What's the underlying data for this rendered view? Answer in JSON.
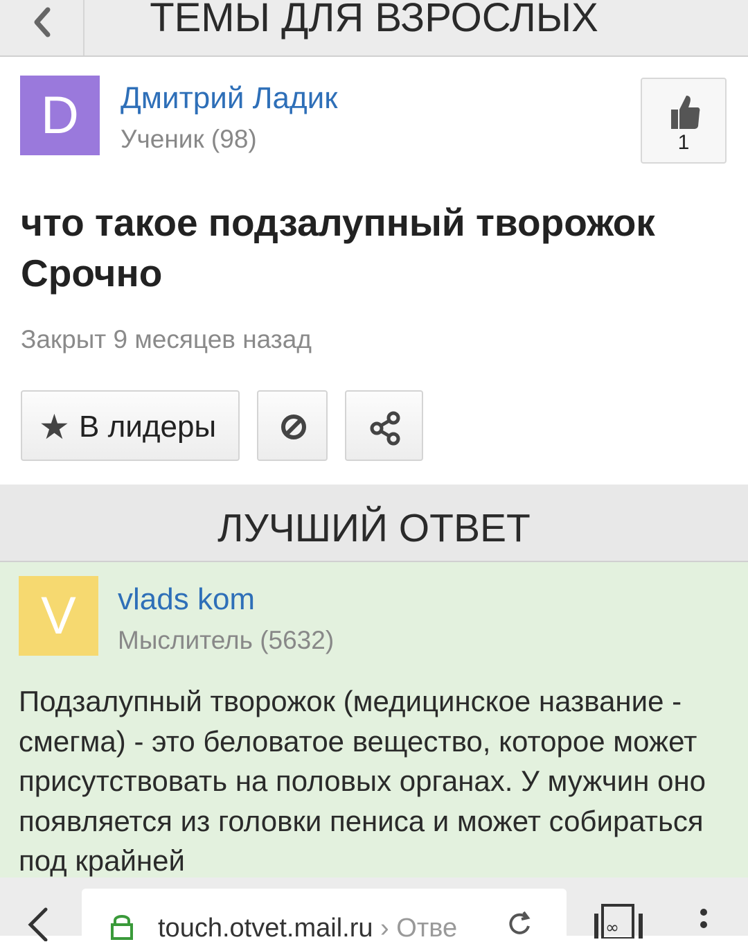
{
  "header": {
    "title": "ТЕМЫ ДЛЯ ВЗРОСЛЫХ"
  },
  "question": {
    "author": {
      "initial": "D",
      "name": "Дмитрий Ладик",
      "rank": "Ученик (98)",
      "avatar_color": "#9a79dc"
    },
    "likes": "1",
    "title": "что такое подзалупный творожок Срочно",
    "status": "Закрыт 9 месяцев назад",
    "actions": {
      "leaders_label": "В лидеры"
    }
  },
  "best_answer": {
    "heading": "ЛУЧШИЙ ОТВЕТ",
    "author": {
      "initial": "V",
      "name": "vlads kom",
      "rank": "Мыслитель (5632)",
      "avatar_color": "#f6d970"
    },
    "text": "Подзалупный творожок (медицинское название - смегма) - это беловатое вещество, которое может присутствовать на половых органах. У мужчин оно появляется из головки пениса и может собираться под крайней"
  },
  "browser": {
    "url_host": "touch.otvet.mail.ru",
    "url_rest": "› Отве"
  },
  "colors": {
    "link": "#2e6fb8",
    "answer_bg": "#e3f1de",
    "header_bg": "#ececec"
  }
}
